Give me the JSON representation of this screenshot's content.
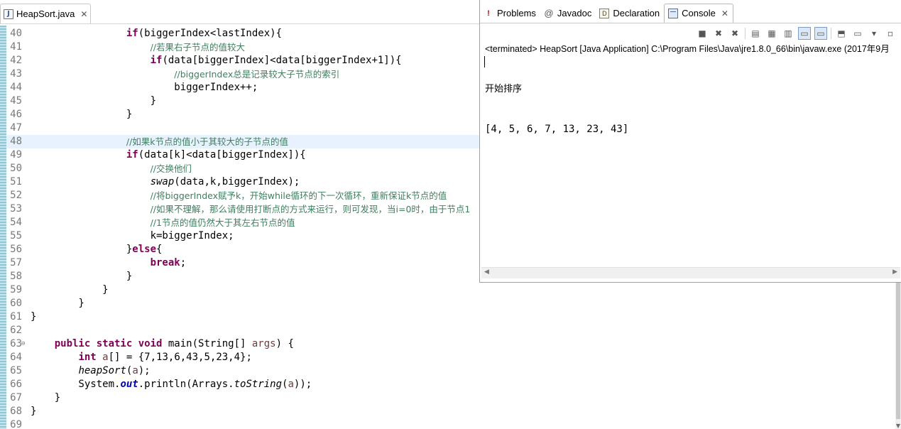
{
  "editor": {
    "tab": {
      "icon": "java-file-icon",
      "label": "HeapSort.java",
      "close": "✕"
    },
    "lines": [
      {
        "n": "40",
        "parts": [
          [
            "t",
            "                "
          ],
          [
            "k",
            "if"
          ],
          [
            "t",
            "(biggerIndex<lastIndex){"
          ]
        ]
      },
      {
        "n": "41",
        "parts": [
          [
            "t",
            "                    "
          ],
          [
            "c",
            "//若果右子节点的值较大"
          ]
        ]
      },
      {
        "n": "42",
        "parts": [
          [
            "t",
            "                    "
          ],
          [
            "k",
            "if"
          ],
          [
            "t",
            "(data[biggerIndex]<data[biggerIndex+1]){"
          ]
        ]
      },
      {
        "n": "43",
        "parts": [
          [
            "t",
            "                        "
          ],
          [
            "c",
            "//biggerIndex总是记录较大子节点的索引"
          ]
        ]
      },
      {
        "n": "44",
        "parts": [
          [
            "t",
            "                        biggerIndex++;"
          ]
        ]
      },
      {
        "n": "45",
        "parts": [
          [
            "t",
            "                    }"
          ]
        ]
      },
      {
        "n": "46",
        "parts": [
          [
            "t",
            "                }"
          ]
        ]
      },
      {
        "n": "47",
        "parts": []
      },
      {
        "n": "48",
        "current": true,
        "parts": [
          [
            "t",
            "                "
          ],
          [
            "c",
            "//如果k节点的值小于其较大的子节点的值"
          ]
        ]
      },
      {
        "n": "49",
        "parts": [
          [
            "t",
            "                "
          ],
          [
            "k",
            "if"
          ],
          [
            "t",
            "(data[k]<data[biggerIndex]){"
          ]
        ]
      },
      {
        "n": "50",
        "parts": [
          [
            "t",
            "                    "
          ],
          [
            "c",
            "//交换他们"
          ]
        ]
      },
      {
        "n": "51",
        "parts": [
          [
            "t",
            "                    "
          ],
          [
            "i",
            "swap"
          ],
          [
            "t",
            "(data,k,biggerIndex);"
          ]
        ]
      },
      {
        "n": "52",
        "parts": [
          [
            "t",
            "                    "
          ],
          [
            "c",
            "//将biggerIndex赋予k，开始while循环的下一次循环，重新保证k节点的值"
          ]
        ]
      },
      {
        "n": "53",
        "parts": [
          [
            "t",
            "                    "
          ],
          [
            "c",
            "//如果不理解，那么请使用打断点的方式来运行，则可发现，当i=0时，由于节点1"
          ]
        ]
      },
      {
        "n": "54",
        "parts": [
          [
            "t",
            "                    "
          ],
          [
            "c",
            "//1节点的值仍然大于其左右节点的值"
          ]
        ]
      },
      {
        "n": "55",
        "parts": [
          [
            "t",
            "                    k=biggerIndex;"
          ]
        ]
      },
      {
        "n": "56",
        "parts": [
          [
            "t",
            "                }"
          ],
          [
            "k",
            "else"
          ],
          [
            "t",
            "{"
          ]
        ]
      },
      {
        "n": "57",
        "parts": [
          [
            "t",
            "                    "
          ],
          [
            "k",
            "break"
          ],
          [
            "t",
            ";"
          ]
        ]
      },
      {
        "n": "58",
        "parts": [
          [
            "t",
            "                }"
          ]
        ]
      },
      {
        "n": "59",
        "parts": [
          [
            "t",
            "            }"
          ]
        ]
      },
      {
        "n": "60",
        "parts": [
          [
            "t",
            "        }"
          ]
        ]
      },
      {
        "n": "61",
        "parts": [
          [
            "t",
            "}"
          ]
        ]
      },
      {
        "n": "62",
        "parts": []
      },
      {
        "n": "63",
        "fold": "⊖",
        "parts": [
          [
            "t",
            "    "
          ],
          [
            "k",
            "public static void"
          ],
          [
            "t",
            " main(String[] "
          ],
          [
            "p",
            "args"
          ],
          [
            "t",
            ") {"
          ]
        ]
      },
      {
        "n": "64",
        "parts": [
          [
            "t",
            "        "
          ],
          [
            "k",
            "int"
          ],
          [
            "t",
            " "
          ],
          [
            "p",
            "a"
          ],
          [
            "t",
            "[] = {7,13,6,43,5,23,4};"
          ]
        ]
      },
      {
        "n": "65",
        "parts": [
          [
            "t",
            "        "
          ],
          [
            "i",
            "heapSort"
          ],
          [
            "t",
            "("
          ],
          [
            "p",
            "a"
          ],
          [
            "t",
            ");"
          ]
        ]
      },
      {
        "n": "66",
        "parts": [
          [
            "t",
            "        System."
          ],
          [
            "f",
            "out"
          ],
          [
            "t",
            ".println(Arrays."
          ],
          [
            "i",
            "toString"
          ],
          [
            "t",
            "("
          ],
          [
            "p",
            "a"
          ],
          [
            "t",
            "));"
          ]
        ]
      },
      {
        "n": "67",
        "parts": [
          [
            "t",
            "    }"
          ]
        ]
      },
      {
        "n": "68",
        "parts": [
          [
            "t",
            "}"
          ]
        ]
      },
      {
        "n": "69",
        "parts": []
      }
    ]
  },
  "views": {
    "tabs": [
      {
        "name": "problems",
        "icon": "problems-icon",
        "glyph": "!",
        "label": "Problems"
      },
      {
        "name": "javadoc",
        "icon": "javadoc-icon",
        "glyph": "@",
        "label": "Javadoc"
      },
      {
        "name": "declaration",
        "icon": "declaration-icon",
        "glyph": "D",
        "label": "Declaration"
      },
      {
        "name": "console",
        "icon": "console-icon",
        "glyph": "",
        "label": "Console",
        "active": true,
        "close": "✕"
      }
    ],
    "toolbar": [
      {
        "name": "terminate-icon",
        "glyph": "■"
      },
      {
        "name": "remove-launch-icon",
        "glyph": "✖"
      },
      {
        "name": "remove-all-launches-icon",
        "glyph": "✖"
      },
      {
        "name": "clear-console-icon",
        "glyph": "▤"
      },
      {
        "name": "scroll-lock-icon",
        "glyph": "▦"
      },
      {
        "name": "word-wrap-icon",
        "glyph": "▥"
      },
      {
        "name": "show-on-stdout-icon",
        "glyph": "▭",
        "pressed": true
      },
      {
        "name": "show-on-stderr-icon",
        "glyph": "▭",
        "pressed": true
      },
      {
        "name": "pin-console-icon",
        "glyph": "⬒"
      },
      {
        "name": "display-console-icon",
        "glyph": "▭"
      },
      {
        "name": "display-console-dropdown-icon",
        "glyph": "▾"
      },
      {
        "name": "open-console-icon",
        "glyph": "▫"
      }
    ],
    "console_header": "<terminated> HeapSort [Java Application] C:\\Program Files\\Java\\jre1.8.0_66\\bin\\javaw.exe (2017年9月",
    "console_output": [
      "开始排序",
      "[4, 5, 6, 7, 13, 23, 43]"
    ]
  },
  "scrollbars": {
    "editor_down_arrow": "▼",
    "console_left_arrow": "◀",
    "console_right_arrow": "▶"
  }
}
